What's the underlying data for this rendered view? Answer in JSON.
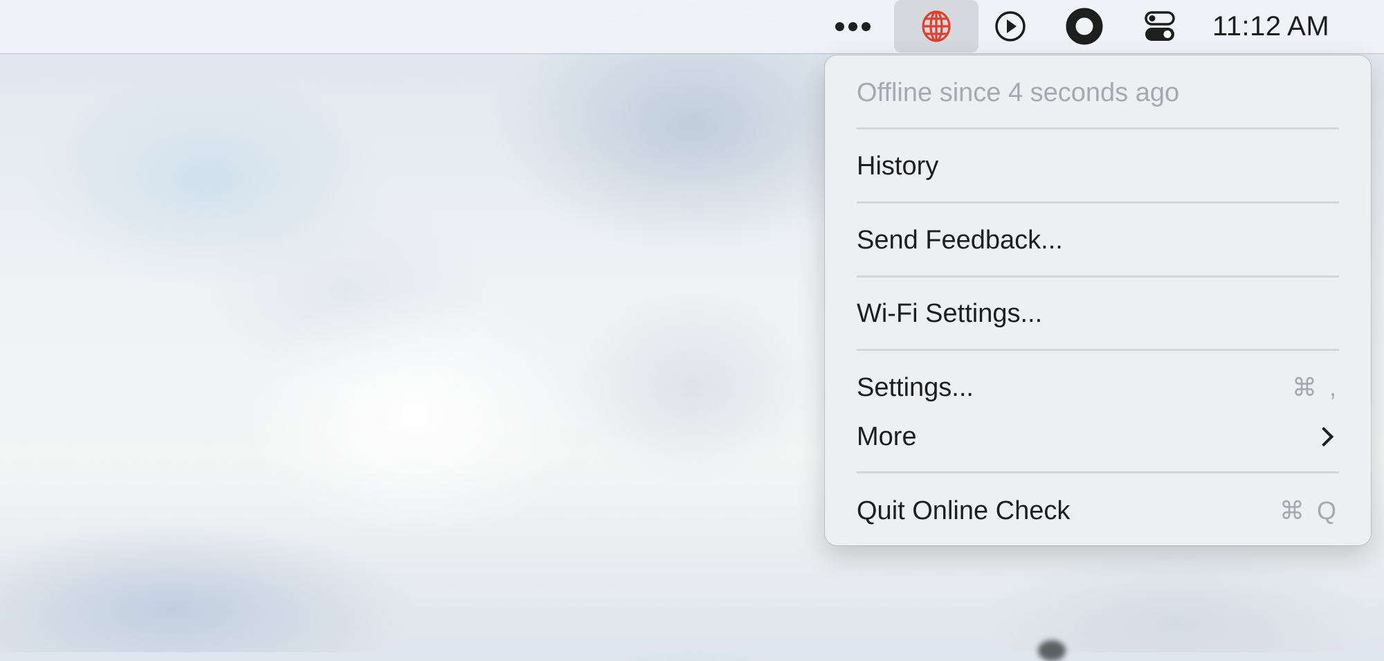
{
  "menubar": {
    "items": [
      {
        "name": "overflow",
        "icon": "ellipsis-icon"
      },
      {
        "name": "online-check",
        "icon": "globe-icon",
        "active": true,
        "color": "#e0402f"
      },
      {
        "name": "now-playing",
        "icon": "play-circle-icon"
      },
      {
        "name": "screen-record",
        "icon": "record-icon"
      },
      {
        "name": "control-center",
        "icon": "toggles-icon"
      }
    ],
    "clock": "11:12 AM"
  },
  "menu": {
    "status": "Offline since 4 seconds ago",
    "items": [
      {
        "label": "History"
      },
      {
        "label": "Send Feedback..."
      },
      {
        "label": "Wi-Fi Settings..."
      },
      {
        "label": "Settings...",
        "shortcut": "⌘ ,"
      },
      {
        "label": "More",
        "submenu": true
      },
      {
        "label": "Quit Online Check",
        "shortcut": "⌘ Q"
      }
    ]
  }
}
